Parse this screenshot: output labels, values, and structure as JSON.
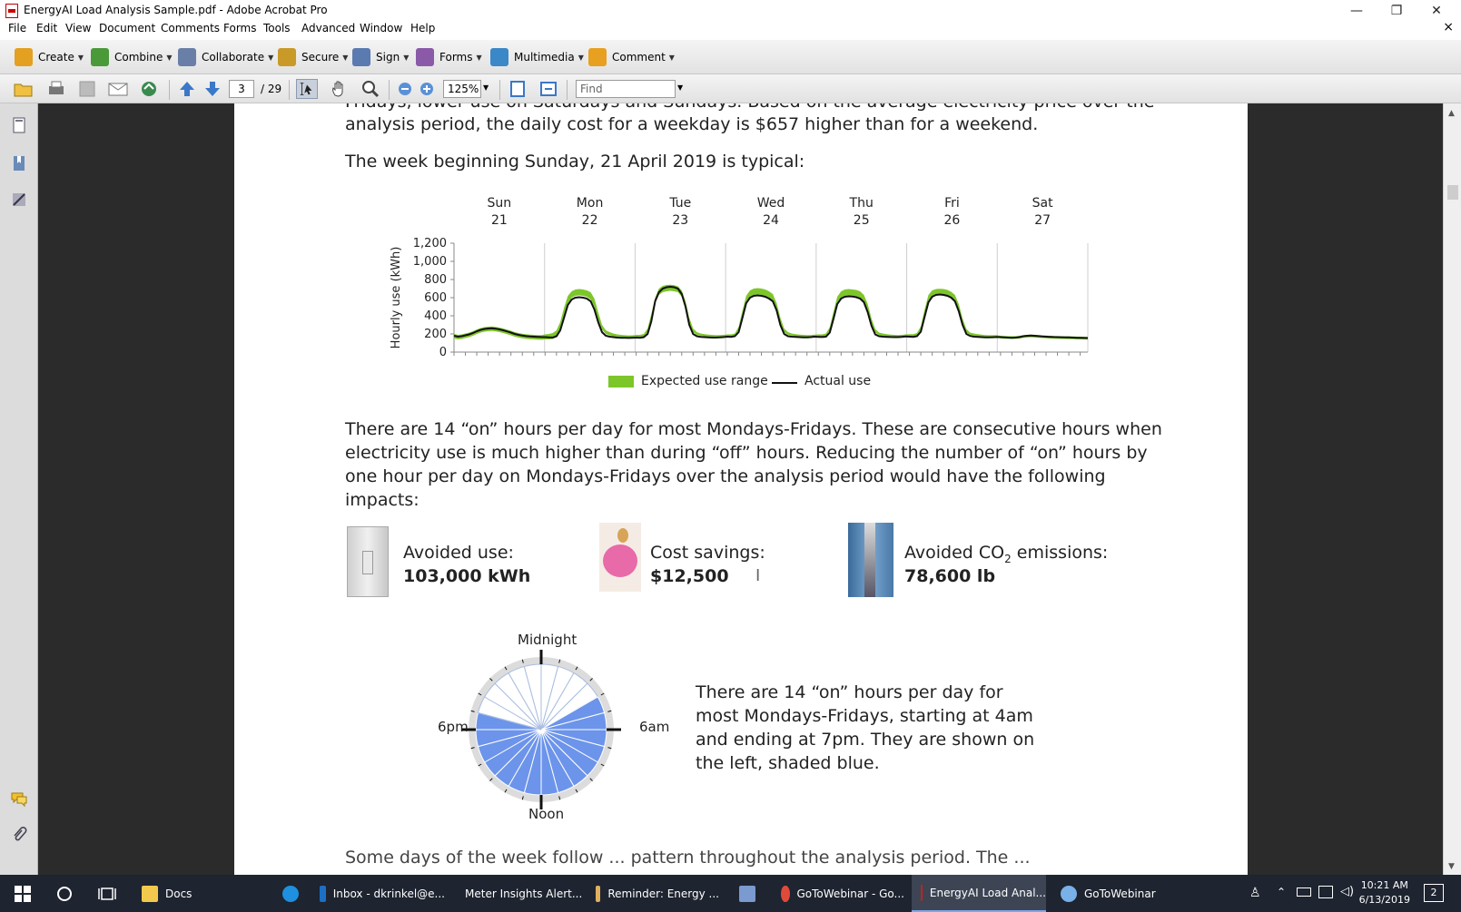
{
  "window": {
    "title": "EnergyAI Load Analysis Sample.pdf - Adobe Acrobat Pro",
    "minimize": "—",
    "restore": "❐",
    "close": "✕",
    "doc_close": "×"
  },
  "menu": [
    "File",
    "Edit",
    "View",
    "Document",
    "Comments",
    "Forms",
    "Tools",
    "Advanced",
    "Window",
    "Help"
  ],
  "toolbar1": [
    {
      "label": "Create",
      "icon": "create-icon",
      "color": "#e4a020"
    },
    {
      "label": "Combine",
      "icon": "combine-icon",
      "color": "#4a9a3a"
    },
    {
      "label": "Collaborate",
      "icon": "collaborate-icon",
      "color": "#6a7fa8"
    },
    {
      "label": "Secure",
      "icon": "lock-icon",
      "color": "#c99a28"
    },
    {
      "label": "Sign",
      "icon": "pen-icon",
      "color": "#5a7ab0"
    },
    {
      "label": "Forms",
      "icon": "forms-icon",
      "color": "#8a5aa8"
    },
    {
      "label": "Multimedia",
      "icon": "multimedia-icon",
      "color": "#3a88c8"
    },
    {
      "label": "Comment",
      "icon": "comment-icon",
      "color": "#e8a020"
    }
  ],
  "toolbar2": {
    "page_current": "3",
    "page_total": "/ 29",
    "zoom": "125%",
    "find_placeholder": "Find"
  },
  "page": {
    "para_top": "Fridays, lower use on Saturdays and Sundays. Based on the average electricity price over the",
    "para_top2": "analysis period, the daily cost for a weekday is $657 higher than for a weekend.",
    "week_line": "The week beginning Sunday, 21 April 2019 is typical:",
    "on_hours_para": [
      "There are 14 “on” hours per day for most Mondays-Fridays. These are consecutive hours when",
      "electricity use is much higher than during “off” hours. Reducing the number of “on” hours by",
      "one hour per day on Mondays-Fridays over the analysis period would have the following",
      "impacts:"
    ],
    "impacts": [
      {
        "label": "Avoided use:",
        "value": "103,000 kWh",
        "icon": "light-switch-icon"
      },
      {
        "label": "Cost savings:",
        "value": "$12,500",
        "icon": "piggy-bank-icon"
      },
      {
        "label_a": "Avoided CO",
        "label_sub": "2",
        "label_b": " emissions:",
        "value": "78,600 lb",
        "icon": "smokestack-icon"
      }
    ],
    "clock_para": [
      "There are 14 “on” hours per day for",
      "most Mondays-Fridays, starting at 4am",
      "and ending at 7pm. They are shown on",
      "the left, shaded blue."
    ],
    "clock_labels": {
      "top": "Midnight",
      "right": "6am",
      "bottom": "Noon",
      "left": "6pm"
    },
    "bottom_cut": "Some days of the week follow ... pattern throughout the analysis period. The ..."
  },
  "chart_data": {
    "type": "line",
    "ylabel": "Hourly use (kWh)",
    "yticks": [
      "0",
      "200",
      "400",
      "600",
      "800",
      "1,000",
      "1,200"
    ],
    "ylim": [
      0,
      1200
    ],
    "days": [
      {
        "name": "Sun",
        "date": "21"
      },
      {
        "name": "Mon",
        "date": "22"
      },
      {
        "name": "Tue",
        "date": "23"
      },
      {
        "name": "Wed",
        "date": "24"
      },
      {
        "name": "Thu",
        "date": "25"
      },
      {
        "name": "Fri",
        "date": "26"
      },
      {
        "name": "Sat",
        "date": "27"
      }
    ],
    "legend": {
      "range": "Expected use range",
      "actual": "Actual use"
    },
    "colors": {
      "range": "#7dc62a",
      "actual": "#111111"
    },
    "actual_daily_shape": {
      "weekend": [
        170,
        160,
        200,
        240,
        260,
        250,
        180,
        160
      ],
      "weekday_peaks": [
        600,
        720,
        640,
        620,
        640
      ]
    },
    "actual": [
      180,
      170,
      175,
      185,
      195,
      210,
      230,
      245,
      255,
      260,
      262,
      258,
      250,
      240,
      228,
      215,
      200,
      190,
      182,
      176,
      172,
      170,
      168,
      166,
      165,
      162,
      160,
      175,
      240,
      380,
      520,
      580,
      600,
      605,
      600,
      590,
      560,
      470,
      330,
      220,
      180,
      170,
      165,
      160,
      158,
      157,
      156,
      158,
      160,
      158,
      165,
      200,
      340,
      560,
      660,
      700,
      715,
      720,
      715,
      700,
      640,
      500,
      300,
      200,
      175,
      168,
      165,
      162,
      160,
      160,
      162,
      165,
      170,
      168,
      175,
      220,
      380,
      540,
      600,
      620,
      625,
      620,
      610,
      590,
      560,
      460,
      300,
      200,
      175,
      170,
      168,
      165,
      162,
      162,
      165,
      170,
      168,
      166,
      170,
      215,
      370,
      530,
      590,
      610,
      615,
      612,
      605,
      590,
      550,
      440,
      290,
      195,
      175,
      170,
      168,
      166,
      165,
      165,
      168,
      172,
      170,
      168,
      175,
      225,
      390,
      550,
      610,
      630,
      635,
      630,
      620,
      600,
      560,
      450,
      300,
      200,
      178,
      170,
      168,
      165,
      163,
      162,
      164,
      166,
      165,
      163,
      160,
      158,
      160,
      165,
      175,
      180,
      182,
      180,
      176,
      172,
      170,
      168,
      166,
      165,
      164,
      163,
      162,
      160,
      158,
      157,
      156,
      155
    ],
    "range_low": [
      150,
      140,
      145,
      155,
      165,
      180,
      200,
      215,
      225,
      230,
      232,
      228,
      220,
      210,
      198,
      185,
      170,
      160,
      152,
      146,
      142,
      140,
      138,
      136,
      140,
      140,
      145,
      170,
      240,
      400,
      540,
      600,
      620,
      625,
      620,
      610,
      580,
      500,
      360,
      250,
      200,
      185,
      175,
      170,
      165,
      162,
      160,
      160,
      160,
      160,
      170,
      220,
      360,
      540,
      630,
      660,
      670,
      675,
      670,
      660,
      610,
      490,
      320,
      220,
      190,
      180,
      175,
      170,
      168,
      166,
      166,
      168,
      170,
      170,
      180,
      240,
      400,
      560,
      610,
      630,
      635,
      630,
      620,
      600,
      570,
      470,
      320,
      220,
      190,
      182,
      176,
      172,
      170,
      168,
      168,
      170,
      170,
      170,
      180,
      235,
      390,
      550,
      600,
      620,
      625,
      622,
      615,
      600,
      560,
      460,
      310,
      215,
      188,
      180,
      175,
      170,
      168,
      168,
      170,
      172,
      172,
      172,
      182,
      245,
      410,
      565,
      615,
      630,
      632,
      628,
      618,
      598,
      555,
      455,
      310,
      215,
      190,
      180,
      175,
      170,
      166,
      164,
      165,
      166,
      150,
      148,
      146,
      145,
      146,
      150,
      156,
      160,
      162,
      160,
      158,
      155,
      152,
      150,
      148,
      146,
      145,
      144,
      143,
      142,
      141,
      140,
      139,
      138
    ],
    "range_high": [
      200,
      190,
      195,
      205,
      215,
      230,
      250,
      265,
      275,
      280,
      282,
      278,
      270,
      260,
      248,
      235,
      220,
      210,
      202,
      196,
      192,
      190,
      188,
      186,
      195,
      200,
      210,
      240,
      330,
      490,
      620,
      670,
      690,
      695,
      690,
      680,
      660,
      590,
      440,
      300,
      240,
      220,
      205,
      195,
      190,
      186,
      184,
      185,
      190,
      190,
      200,
      260,
      420,
      600,
      700,
      730,
      740,
      742,
      738,
      725,
      680,
      560,
      380,
      260,
      220,
      205,
      198,
      192,
      190,
      188,
      188,
      190,
      195,
      195,
      205,
      280,
      460,
      620,
      680,
      700,
      705,
      700,
      690,
      670,
      640,
      540,
      380,
      260,
      220,
      205,
      198,
      192,
      190,
      188,
      188,
      192,
      195,
      195,
      205,
      275,
      450,
      610,
      670,
      690,
      695,
      690,
      685,
      670,
      630,
      530,
      370,
      255,
      215,
      205,
      198,
      192,
      190,
      188,
      190,
      195,
      198,
      198,
      210,
      285,
      470,
      630,
      680,
      695,
      698,
      695,
      685,
      665,
      630,
      530,
      370,
      255,
      215,
      205,
      198,
      192,
      188,
      186,
      186,
      188,
      180,
      178,
      176,
      175,
      176,
      180,
      186,
      190,
      192,
      190,
      188,
      185,
      182,
      180,
      178,
      176,
      175,
      174,
      173,
      172,
      171,
      170,
      169,
      168
    ]
  },
  "leftnav": [
    "pages-icon",
    "bookmarks-icon",
    "signatures-icon",
    "comments-icon",
    "attachments-icon"
  ],
  "taskbar": {
    "items": [
      {
        "label": "Docs",
        "icon": "folder-icon",
        "color": "#f2c94c"
      },
      {
        "label": "",
        "icon": "ie-icon",
        "color": "#1f8fe0"
      },
      {
        "label": "Inbox - dkrinkel@e...",
        "icon": "outlook-icon",
        "color": "#1d6fc4"
      },
      {
        "label": "Meter Insights Alert...",
        "icon": "mail-icon",
        "color": "#e0b060"
      },
      {
        "label": "Reminder: Energy ...",
        "icon": "mail-icon",
        "color": "#e0b060"
      },
      {
        "label": "",
        "icon": "app-icon",
        "color": "#7a9ad0"
      },
      {
        "label": "GoToWebinar - Go...",
        "icon": "chrome-icon",
        "color": "#e04a3a"
      },
      {
        "label": "EnergyAI Load Anal...",
        "icon": "acrobat-icon",
        "color": "#c0241c"
      },
      {
        "label": "GoToWebinar",
        "icon": "gotowebinar-icon",
        "color": "#7ab0e8"
      }
    ],
    "time": "10:21 AM",
    "date": "6/13/2019",
    "notif": "2"
  }
}
